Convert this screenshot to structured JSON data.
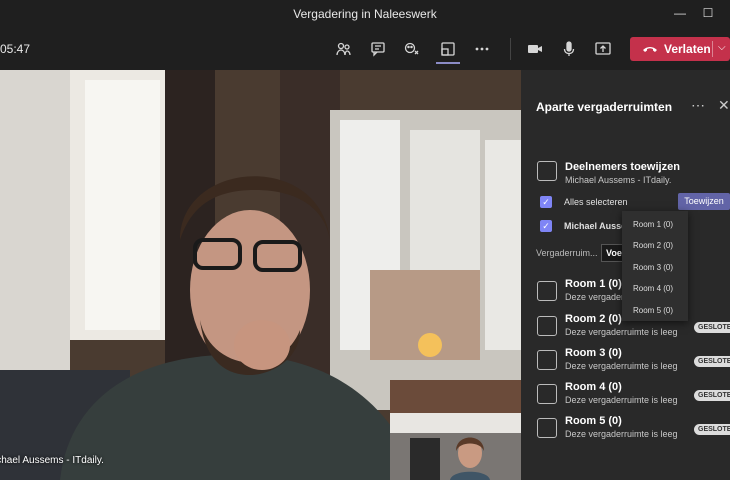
{
  "window": {
    "title": "Vergadering in Naleeswerk",
    "minimize": "—",
    "maximize": "☐"
  },
  "toolbar": {
    "timer": "05:47",
    "icons": [
      "people-icon",
      "chat-icon",
      "reactions-icon",
      "breakout-rooms-icon",
      "more-icon",
      "camera-icon",
      "mic-icon",
      "share-icon"
    ],
    "leave_label": "Verlaten",
    "leave_color": "#c4314b"
  },
  "video": {
    "participant_name": "ichael Aussems - ITdaily."
  },
  "panel": {
    "title": "Aparte vergaderruimten",
    "assign": {
      "title": "Deelnemers toewijzen",
      "subtitle": "Michael Aussems - ITdaily."
    },
    "select_all_label": "Alles selecteren",
    "participant_label": "Michael Ausser",
    "assign_button": "Toewijzen",
    "filter_label": "Vergaderruim...",
    "filter_button": "Voe",
    "rooms": [
      {
        "name": "Room 1 (0)",
        "status": "Deze vergader",
        "badge": ""
      },
      {
        "name": "Room 2 (0)",
        "status": "Deze vergaderruimte is leeg",
        "badge": "GESLOTEN"
      },
      {
        "name": "Room 3 (0)",
        "status": "Deze vergaderruimte is leeg",
        "badge": "GESLOTEN"
      },
      {
        "name": "Room 4 (0)",
        "status": "Deze vergaderruimte is leeg",
        "badge": "GESLOTEN"
      },
      {
        "name": "Room 5 (0)",
        "status": "Deze vergaderruimte is leeg",
        "badge": "GESLOTEN"
      }
    ]
  },
  "dropdown": {
    "options": [
      "Room 1 (0)",
      "Room 2 (0)",
      "Room 3 (0)",
      "Room 4 (0)",
      "Room 5 (0)"
    ]
  },
  "colors": {
    "accent": "#6264a7",
    "checkbox": "#7f85f5",
    "panel_bg": "#292929"
  }
}
